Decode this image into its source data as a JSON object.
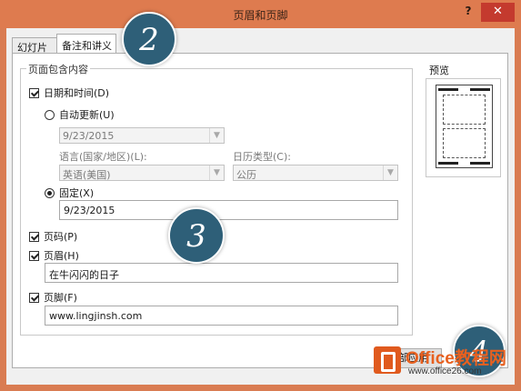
{
  "window": {
    "title": "页眉和页脚",
    "help": "?",
    "close": "✕"
  },
  "tabs": [
    {
      "label": "幻灯片",
      "active": false
    },
    {
      "label": "备注和讲义",
      "active": true
    }
  ],
  "group": {
    "legend": "页面包含内容"
  },
  "date_time": {
    "label": "日期和时间(D)",
    "checked": true,
    "auto_update": {
      "label": "自动更新(U)",
      "selected": false,
      "value": "9/23/2015"
    },
    "language_label": "语言(国家/地区)(L):",
    "language_value": "英语(美国)",
    "calendar_label": "日历类型(C):",
    "calendar_value": "公历",
    "fixed": {
      "label": "固定(X)",
      "selected": true,
      "value": "9/23/2015"
    }
  },
  "page_number": {
    "label": "页码(P)",
    "checked": true
  },
  "header": {
    "label": "页眉(H)",
    "checked": true,
    "value": "在牛闪闪的日子"
  },
  "footer": {
    "label": "页脚(F)",
    "checked": true,
    "value": "www.lingjinsh.com"
  },
  "preview": {
    "label": "预览"
  },
  "buttons": {
    "apply_all": "全部应用"
  },
  "badges": [
    "2",
    "3",
    "4"
  ],
  "watermark": {
    "brand": "Office教程网",
    "url": "www.office26.com"
  },
  "colors": {
    "frame": "#de7b4f",
    "close": "#c43a2e",
    "badge": "#2e5f78",
    "brand": "#e8601f"
  }
}
